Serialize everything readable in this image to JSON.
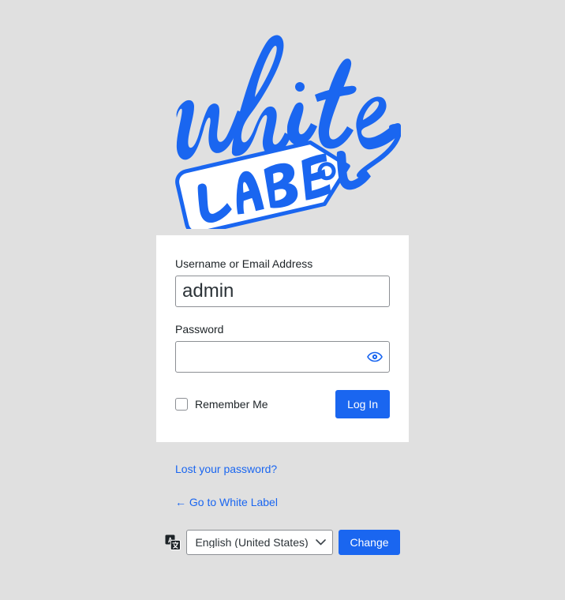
{
  "page": {
    "background_color": "#e0e0e0",
    "accent_color": "#1a66f0",
    "card_background": "#ffffff"
  },
  "logo": {
    "name": "white-label-logo",
    "alt": "White Label",
    "script_text": "white",
    "tag_text": "LABEL",
    "color": "#1a66f0"
  },
  "form": {
    "username": {
      "label": "Username or Email Address",
      "value": "admin",
      "placeholder": ""
    },
    "password": {
      "label": "Password",
      "value": "",
      "placeholder": "",
      "toggle_icon": "eye-icon"
    },
    "remember": {
      "label": "Remember Me",
      "checked": false
    },
    "submit_label": "Log In"
  },
  "links": {
    "lost_password": "Lost your password?",
    "back_to_site": "← Go to White Label"
  },
  "language": {
    "icon": "translate-icon",
    "selected": "English (United States)",
    "options": [
      "English (United States)"
    ],
    "change_label": "Change",
    "chevron_icon": "chevron-down-icon"
  }
}
